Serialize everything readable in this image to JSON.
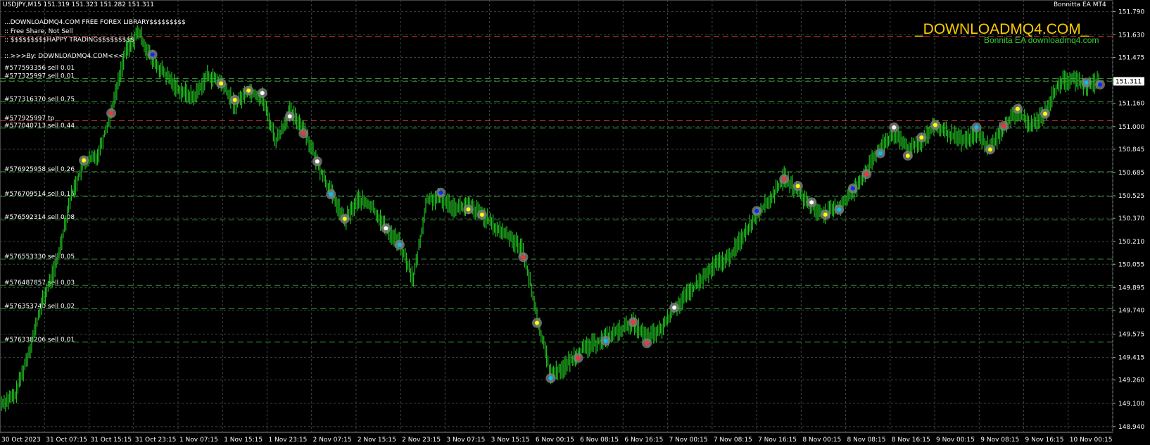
{
  "header": {
    "symbol_info": "USDJPY,M15  151.319 151.323 151.282 151.311",
    "ea_name": "Bonnitta EA MT4",
    "lines": [
      "#577593356 sell 0.01",
      "...DOWNLOADMQ4.COM FREE FOREX LIBRARY$$$$$$$$$",
      ":: Free Share, Not Sell",
      ":: $$$$$$$$$HAPPY TRADING$$$$$$$$$",
      ":: >>>By: DOWNLOADMQ4.COM<<<"
    ]
  },
  "brand": {
    "title": "_DOWNLOADMQ4.COM_",
    "subtitle": "Bonnita EA  downloadmq4.com"
  },
  "chart_data": {
    "type": "line",
    "price_axis": [
      "151.790",
      "151.630",
      "151.475",
      "151.315",
      "151.160",
      "151.000",
      "150.845",
      "150.685",
      "150.525",
      "150.370",
      "150.210",
      "150.055",
      "149.895",
      "149.740",
      "149.575",
      "149.415",
      "149.260",
      "149.100",
      "148.940"
    ],
    "current_price": "151.311",
    "time_axis": [
      "30 Oct 2023",
      "31 Oct 07:15",
      "31 Oct 15:15",
      "31 Oct 23:15",
      "1 Nov 07:15",
      "1 Nov 15:15",
      "1 Nov 23:15",
      "2 Nov 07:15",
      "2 Nov 15:15",
      "2 Nov 23:15",
      "3 Nov 07:15",
      "3 Nov 15:15",
      "6 Nov 00:15",
      "6 Nov 08:15",
      "6 Nov 16:15",
      "7 Nov 00:15",
      "7 Nov 08:15",
      "7 Nov 16:15",
      "8 Nov 00:15",
      "8 Nov 08:15",
      "8 Nov 16:15",
      "9 Nov 00:15",
      "9 Nov 08:15",
      "9 Nov 16:15",
      "10 Nov 00:15"
    ],
    "orders": [
      {
        "label": "#577325997 sell 0.01",
        "price": 151.33
      },
      {
        "label": "#577316370 sell 0.75",
        "price": 151.17
      },
      {
        "label": "#577925997 tp",
        "price": 151.04
      },
      {
        "label": "#577040713 sell 0.44",
        "price": 150.99
      },
      {
        "label": "#576925958 sell 0.26",
        "price": 150.69
      },
      {
        "label": "#576709514 sell 0.15",
        "price": 150.52
      },
      {
        "label": "#576592314 sell 0.08",
        "price": 150.36
      },
      {
        "label": "#576553330 sell 0.05",
        "price": 150.09
      },
      {
        "label": "#576487857 sell 0.03",
        "price": 149.91
      },
      {
        "label": "#576353740 sell 0.02",
        "price": 149.75
      },
      {
        "label": "#576338206 sell 0.01",
        "price": 149.52
      }
    ],
    "series": [
      {
        "values": [
          149.1,
          149.15,
          149.45,
          149.8,
          150.05,
          150.5,
          150.75,
          150.8,
          151.1,
          151.5,
          151.65,
          151.45,
          151.35,
          151.25,
          151.2,
          151.35,
          151.3,
          151.15,
          151.25,
          151.2,
          150.9,
          151.1,
          151.0,
          150.75,
          150.55,
          150.35,
          150.5,
          150.45,
          150.3,
          150.2,
          149.95,
          150.5,
          150.5,
          150.45,
          150.45,
          150.4,
          150.3,
          150.25,
          150.15,
          149.7,
          149.3,
          149.35,
          149.45,
          149.5,
          149.55,
          149.6,
          149.65,
          149.55,
          149.6,
          149.75,
          149.85,
          149.95,
          150.05,
          150.1,
          150.25,
          150.4,
          150.5,
          150.65,
          150.55,
          150.45,
          150.4,
          150.45,
          150.55,
          150.7,
          150.85,
          150.95,
          150.85,
          150.9,
          151.0,
          150.95,
          150.9,
          150.95,
          150.85,
          151.0,
          151.1,
          151.0,
          151.1,
          151.3,
          151.33,
          151.28,
          151.311
        ]
      }
    ],
    "grid": true
  },
  "colors": {
    "background": "#000000",
    "grid": "#3a4a3a",
    "candle": "#20c020",
    "order_line": "#2e8b2e",
    "tp_line": "#cc3030",
    "marker_ring": "#808080"
  }
}
